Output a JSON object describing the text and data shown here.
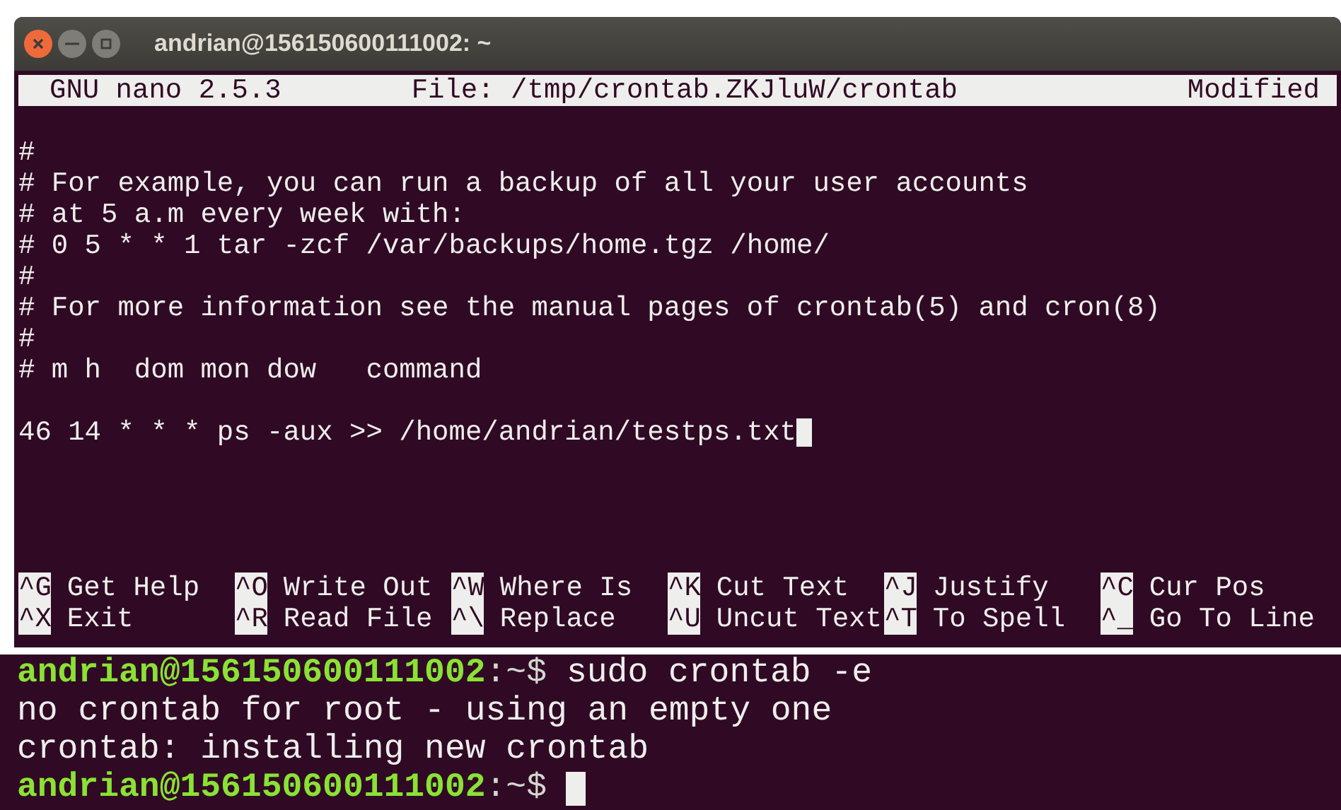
{
  "window": {
    "title": "andrian@156150600111002: ~"
  },
  "nano": {
    "version": "GNU nano 2.5.3",
    "file": "File: /tmp/crontab.ZKJluW/crontab",
    "status": "Modified",
    "lines": [
      {
        "kind": "blank"
      },
      {
        "kind": "text",
        "text": "#"
      },
      {
        "kind": "text",
        "text": "# For example, you can run a backup of all your user accounts"
      },
      {
        "kind": "text",
        "text": "# at 5 a.m every week with:"
      },
      {
        "kind": "text",
        "text": "# 0 5 * * 1 tar -zcf /var/backups/home.tgz /home/"
      },
      {
        "kind": "text",
        "text": "#"
      },
      {
        "kind": "text",
        "text": "# For more information see the manual pages of crontab(5) and cron(8)"
      },
      {
        "kind": "text",
        "text": "#"
      },
      {
        "kind": "text",
        "text": "# m h  dom mon dow   command"
      },
      {
        "kind": "blank"
      },
      {
        "kind": "cursor",
        "text": "46 14 * * * ps -aux >> /home/andrian/testps.txt"
      },
      {
        "kind": "blank"
      },
      {
        "kind": "blank"
      },
      {
        "kind": "blank"
      },
      {
        "kind": "blank"
      }
    ],
    "shortcuts": [
      {
        "key": "^G",
        "label": "Get Help"
      },
      {
        "key": "^O",
        "label": "Write Out"
      },
      {
        "key": "^W",
        "label": "Where Is"
      },
      {
        "key": "^K",
        "label": "Cut Text"
      },
      {
        "key": "^J",
        "label": "Justify"
      },
      {
        "key": "^C",
        "label": "Cur Pos"
      },
      {
        "key": "^X",
        "label": "Exit"
      },
      {
        "key": "^R",
        "label": "Read File"
      },
      {
        "key": "^\\",
        "label": "Replace"
      },
      {
        "key": "^U",
        "label": "Uncut Text"
      },
      {
        "key": "^T",
        "label": "To Spell"
      },
      {
        "key": "^_",
        "label": "Go To Line"
      }
    ]
  },
  "terminal": {
    "lines": [
      {
        "kind": "prompt",
        "user_host": "andrian@156150600111002",
        "path": ":~$",
        "command": "sudo crontab -e"
      },
      {
        "kind": "output",
        "text": "no crontab for root - using an empty one"
      },
      {
        "kind": "output",
        "text": "crontab: installing new crontab"
      },
      {
        "kind": "prompt",
        "user_host": "andrian@156150600111002",
        "path": ":~$",
        "cursor": true
      }
    ]
  }
}
